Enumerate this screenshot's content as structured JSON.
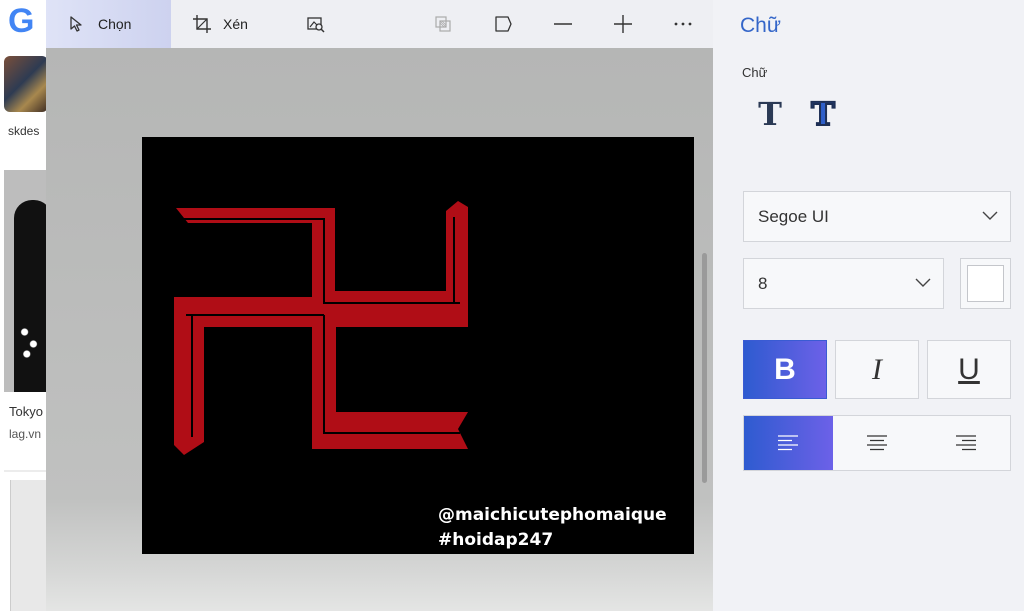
{
  "background_page": {
    "logo_letter": "G",
    "item1_caption": "skdes",
    "item2_title": "Tokyo",
    "item2_source": "lag.vn"
  },
  "toolbar": {
    "select_label": "Chọn",
    "crop_label": "Xén",
    "icons": [
      "cursor-icon",
      "crop-icon",
      "image-search-icon",
      "overlay-icon",
      "flag-shape-icon",
      "minus-icon",
      "plus-icon",
      "more-icon"
    ]
  },
  "image": {
    "watermark_line1": "@maichicutephomaique",
    "watermark_line2": "#hoidap247",
    "symbol_color": "#b00d16",
    "background_color": "#000000"
  },
  "panel": {
    "title": "Chữ",
    "section_label": "Chữ",
    "font_family_value": "Segoe UI",
    "font_size_value": "8",
    "text_color": "#ffffff",
    "bold_label": "B",
    "italic_label": "I",
    "underline_label": "U",
    "bold_active": true,
    "align_active": "left",
    "accent_color": "#3466c9"
  }
}
